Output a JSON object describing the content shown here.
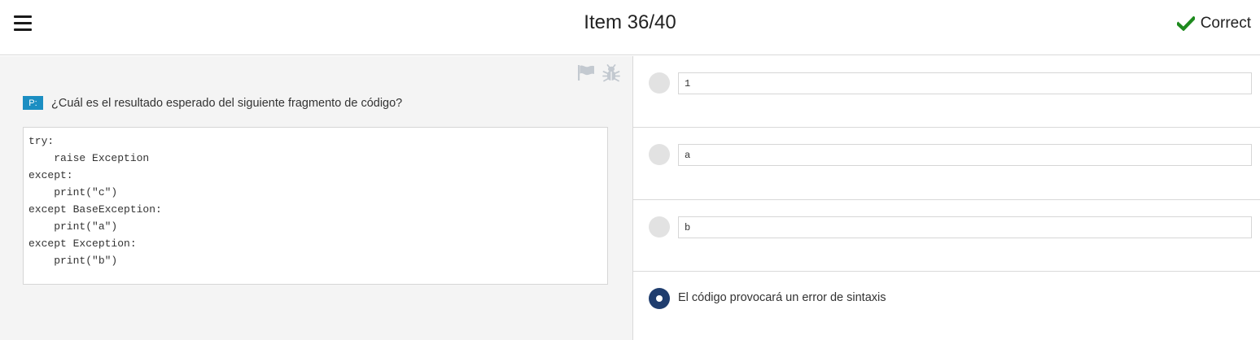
{
  "header": {
    "title": "Item 36/40",
    "result_label": "Correct",
    "result_color": "#1e8a1e",
    "menu_icon": "hamburger-menu-icon"
  },
  "toolbar": {
    "flag_icon": "flag-icon",
    "bug_icon": "bug-report-icon"
  },
  "question": {
    "badge": "P:",
    "text": "¿Cuál es el resultado esperado del siguiente fragmento de código?",
    "code": "try:\n    raise Exception\nexcept:\n    print(\"c\")\nexcept BaseException:\n    print(\"a\")\nexcept Exception:\n    print(\"b\")"
  },
  "options": [
    {
      "label": "1",
      "selected": false
    },
    {
      "label": "a",
      "selected": false
    },
    {
      "label": "b",
      "selected": false
    },
    {
      "label": "El código provocará un error de sintaxis",
      "selected": true
    }
  ],
  "colors": {
    "badge": "#1b8ec2",
    "selected_radio": "#1f3d6e",
    "left_pane": "#f4f4f4"
  }
}
